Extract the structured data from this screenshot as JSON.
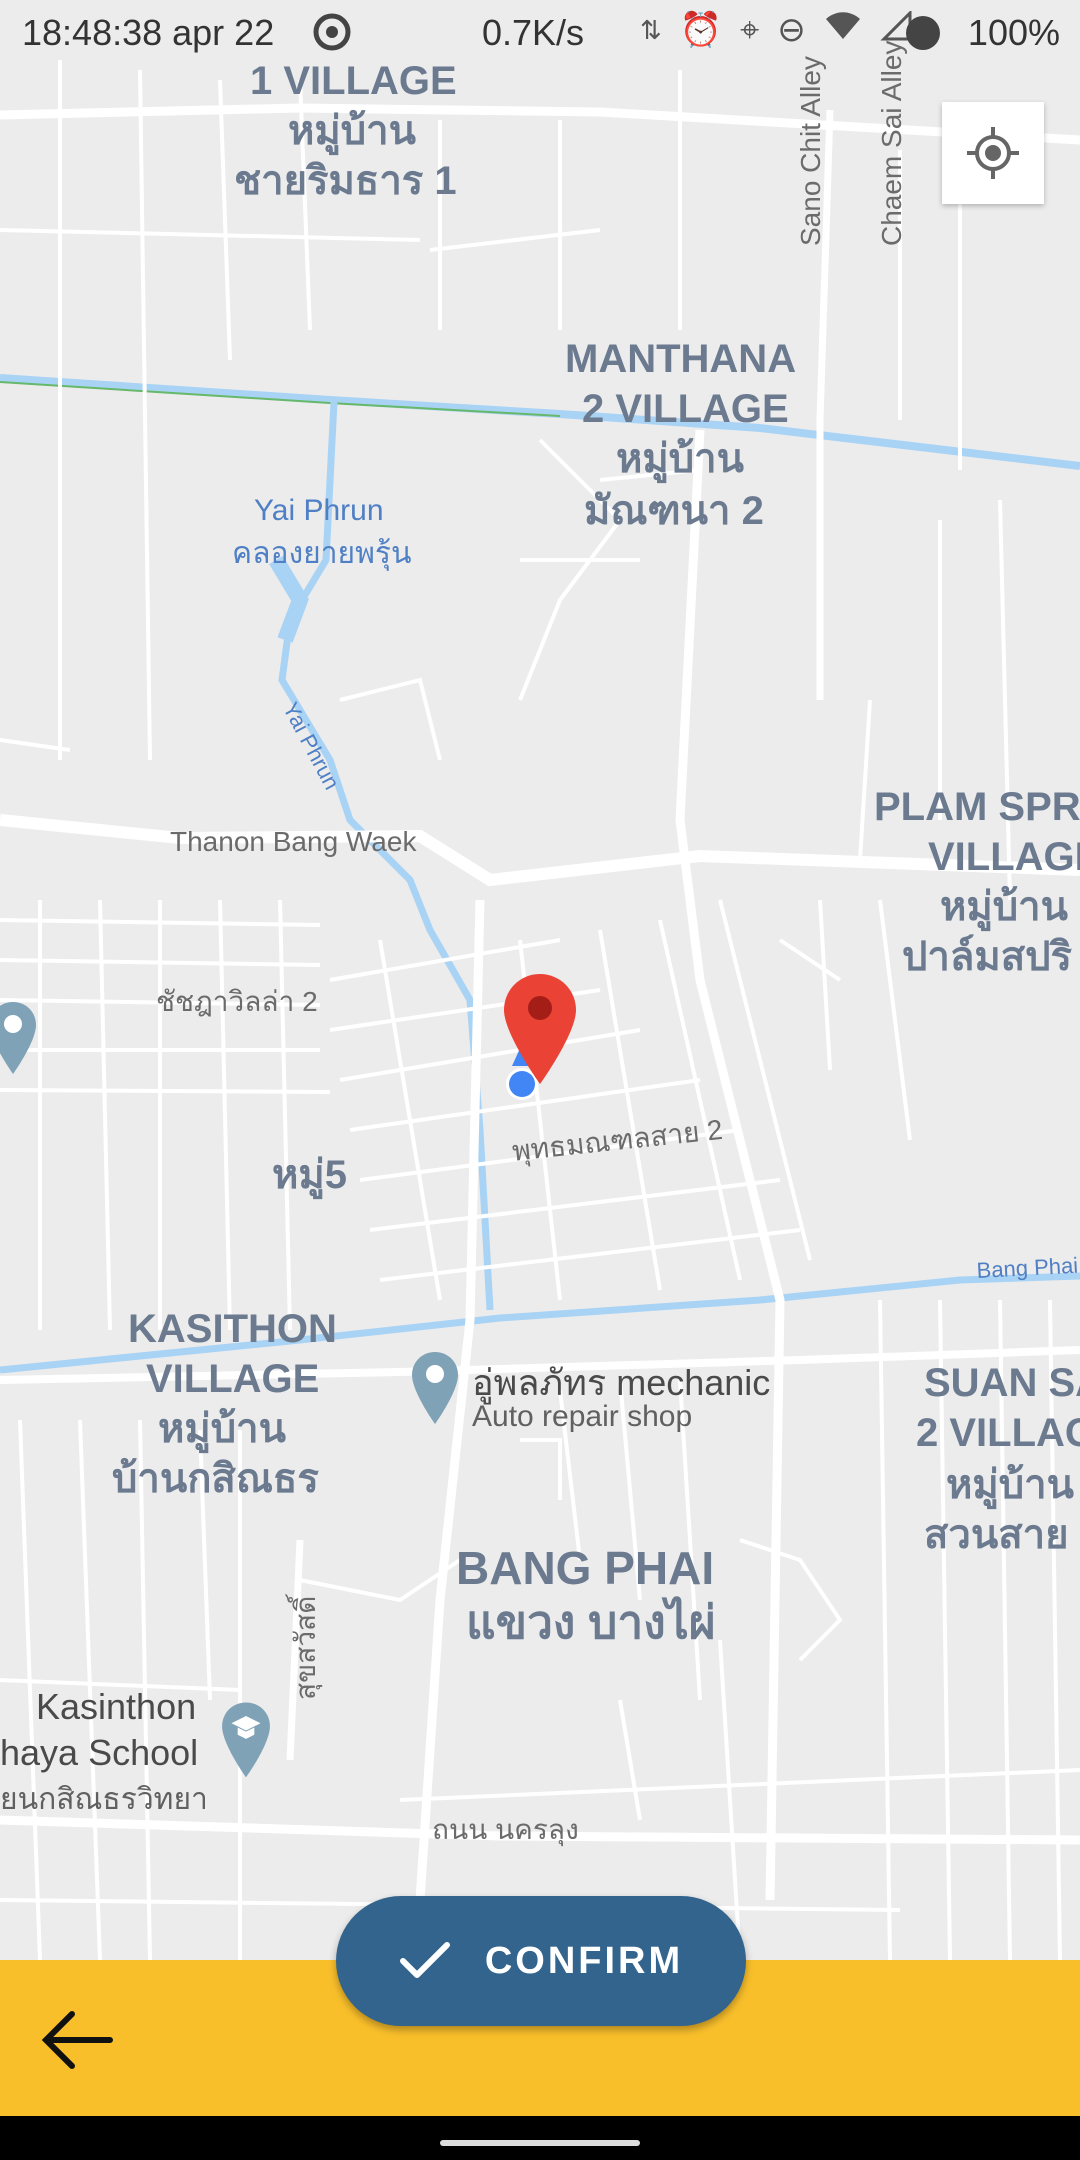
{
  "status_bar": {
    "time": "18:48:38 apr 22",
    "network_speed": "0.7K/s",
    "battery": "100%",
    "icons": [
      "sync-icon",
      "alarm-icon",
      "location-icon",
      "dnd-icon",
      "wifi-icon",
      "signal-icon",
      "battery-icon"
    ]
  },
  "map": {
    "labels": {
      "village1_en": "1 VILLAGE",
      "village1_th1": "หมู่บ้าน",
      "village1_th2": "ชายริมธาร 1",
      "manthana_en1": "MANTHANA",
      "manthana_en2": "2 VILLAGE",
      "manthana_th1": "หมู่บ้าน",
      "manthana_th2": "มัณฑนา 2",
      "sano_chit": "Sano Chit Alley",
      "chaem_sai": "Chaem Sai Alley",
      "yai_phrun_en": "Yai Phrun",
      "yai_phrun_th": "คลองยายพรุ้น",
      "yai_phrun_river": "Yai Phrun",
      "bang_waek": "Thanon Bang Waek",
      "plam_en1": "PLAM SPRI",
      "plam_en2": "VILLAGE",
      "plam_th1": "หมู่บ้าน",
      "plam_th2": "ปาล์มสปริ",
      "chatchada": "ชัชฎาวิลล่า 2",
      "phutthamonthon": "พุทธมณฑลสาย 2",
      "moo5": "หมู่5",
      "bang_phai_canal": "Bang Phai",
      "kasithon_en1": "KASITHON",
      "kasithon_en2": "VILLAGE",
      "kasithon_th1": "หมู่บ้าน",
      "kasithon_th2": "บ้านกสิณธร",
      "mechanic_name": "อู่พลภัทร mechanic",
      "mechanic_type": "Auto repair shop",
      "suan_en1": "SUAN SA",
      "suan_en2": "2 VILLAG",
      "suan_th1": "หมู่บ้าน",
      "suan_th2": "สวนสาย",
      "bang_phai_en": "BANG PHAI",
      "bang_phai_th": "แขวง บางไผ่",
      "sukhsawat": "สุขสวัสดิ์",
      "school1": "Kasinthon",
      "school2": "haya School",
      "school3": "ยนกสิณธรวิทยา",
      "nakhon_lung": "ถนน นครลุง"
    }
  },
  "actions": {
    "confirm_label": "CONFIRM",
    "back_icon": "arrow-left-icon",
    "locate_icon": "my-location-icon"
  },
  "colors": {
    "bottom_bar": "#f9bf2b",
    "confirm_button": "#33648d",
    "pin": "#ea4335",
    "user_dot": "#4285f4",
    "water": "#a9d3f5"
  }
}
